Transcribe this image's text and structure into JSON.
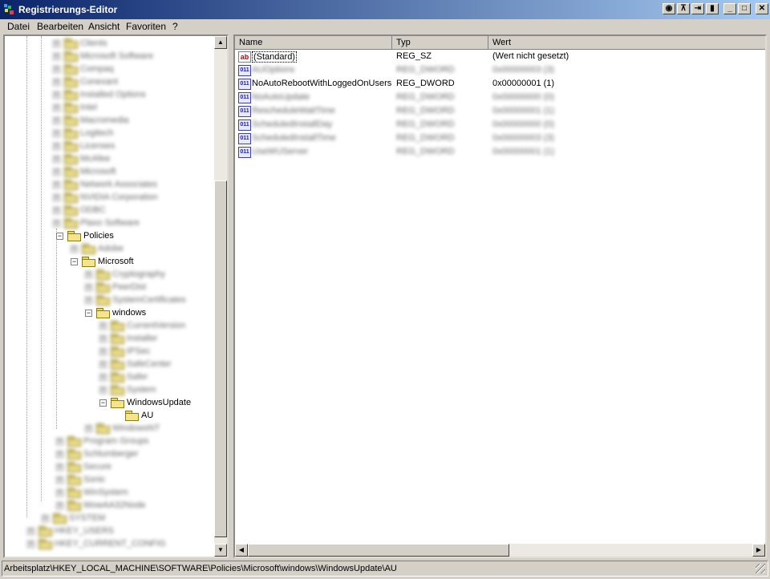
{
  "window": {
    "title": "Registrierungs-Editor"
  },
  "menu": [
    {
      "label": "Datei"
    },
    {
      "label": "Bearbeiten"
    },
    {
      "label": "Ansicht"
    },
    {
      "label": "Favoriten"
    },
    {
      "label": "?"
    }
  ],
  "tree": {
    "visible_nodes": [
      {
        "label": "Policies",
        "expanded": true
      },
      {
        "label": "Microsoft",
        "expanded": true
      },
      {
        "label": "windows",
        "expanded": true
      },
      {
        "label": "WindowsUpdate",
        "expanded": true
      },
      {
        "label": "AU",
        "selected": true
      }
    ],
    "blurred_items": [
      "Clients",
      "Microsoft Software",
      "Compaq",
      "Conexant",
      "Installed Options",
      "Intel",
      "Macromedia",
      "Logitech",
      "Licenses",
      "McAfee",
      "Microsoft",
      "Network Associates",
      "NVIDIA Corporation",
      "ODBC",
      "Plaxo Software",
      "Adobe",
      "Cryptography",
      "PeerDist",
      "SystemCertificates",
      "CurrentVersion",
      "Installer",
      "IPSec",
      "SafeCenter",
      "Safer",
      "System",
      "WindowsNT",
      "Program Groups",
      "Schlumberger",
      "Secure",
      "Sonic",
      "WinSystem",
      "WowAA32Node",
      "SYSTEM",
      "HKEY_USERS",
      "HKEY_CURRENT_CONFIG"
    ]
  },
  "list": {
    "columns": [
      {
        "label": "Name"
      },
      {
        "label": "Typ"
      },
      {
        "label": "Wert"
      }
    ],
    "rows": [
      {
        "name": "(Standard)",
        "type": "REG_SZ",
        "value": "(Wert nicht gesetzt)",
        "icon": "string-value-icon",
        "blurred": false
      },
      {
        "name": "AUOptions",
        "type": "REG_DWORD",
        "value": "0x00000003 (3)",
        "icon": "dword-value-icon",
        "blurred": true
      },
      {
        "name": "NoAutoRebootWithLoggedOnUsers",
        "type": "REG_DWORD",
        "value": "0x00000001 (1)",
        "icon": "dword-value-icon",
        "blurred": false
      },
      {
        "name": "NoAutoUpdate",
        "type": "REG_DWORD",
        "value": "0x00000000 (0)",
        "icon": "dword-value-icon",
        "blurred": true
      },
      {
        "name": "RescheduleWaitTime",
        "type": "REG_DWORD",
        "value": "0x00000001 (1)",
        "icon": "dword-value-icon",
        "blurred": true
      },
      {
        "name": "ScheduledInstallDay",
        "type": "REG_DWORD",
        "value": "0x00000000 (0)",
        "icon": "dword-value-icon",
        "blurred": true
      },
      {
        "name": "ScheduledInstallTime",
        "type": "REG_DWORD",
        "value": "0x00000003 (3)",
        "icon": "dword-value-icon",
        "blurred": true
      },
      {
        "name": "UseWUServer",
        "type": "REG_DWORD",
        "value": "0x00000001 (1)",
        "icon": "dword-value-icon",
        "blurred": true
      }
    ]
  },
  "status": {
    "path": "Arbeitsplatz\\HKEY_LOCAL_MACHINE\\SOFTWARE\\Policies\\Microsoft\\windows\\WindowsUpdate\\AU"
  }
}
